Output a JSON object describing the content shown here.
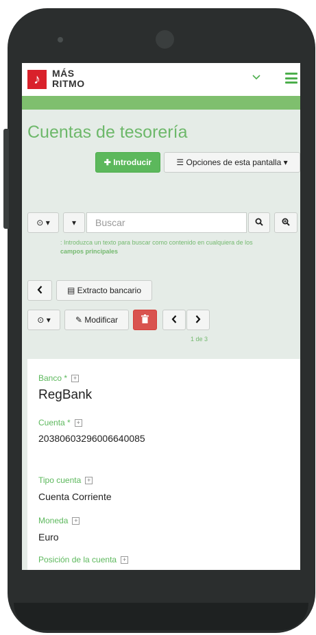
{
  "app": {
    "logo_glyph": "♪",
    "logo_line1": "MÁS",
    "logo_line2": "RITMO",
    "accent_color": "#5cb85c",
    "brand_color": "#d9212b"
  },
  "page": {
    "title": "Cuentas de tesorería"
  },
  "toolbar": {
    "introduce_label": "Introducir",
    "options_label": "Opciones de esta pantalla"
  },
  "search": {
    "placeholder": "Buscar",
    "hint_prefix": ": Introduzca un texto para buscar como contenido en cualquiera de los",
    "hint_link": "campos principales"
  },
  "record_toolbar": {
    "back_icon": "chevron-left",
    "statement_label": "Extracto bancario",
    "modify_label": "Modificar",
    "pager_text": "1 de 3"
  },
  "record": {
    "bank_label": "Banco *",
    "bank_value": "RegBank",
    "account_label": "Cuenta *",
    "account_value": "20380603296006640085",
    "type_label": "Tipo cuenta",
    "type_value": "Cuenta Corriente",
    "currency_label": "Moneda",
    "currency_value": "Euro",
    "position_label": "Posición de la cuenta"
  }
}
